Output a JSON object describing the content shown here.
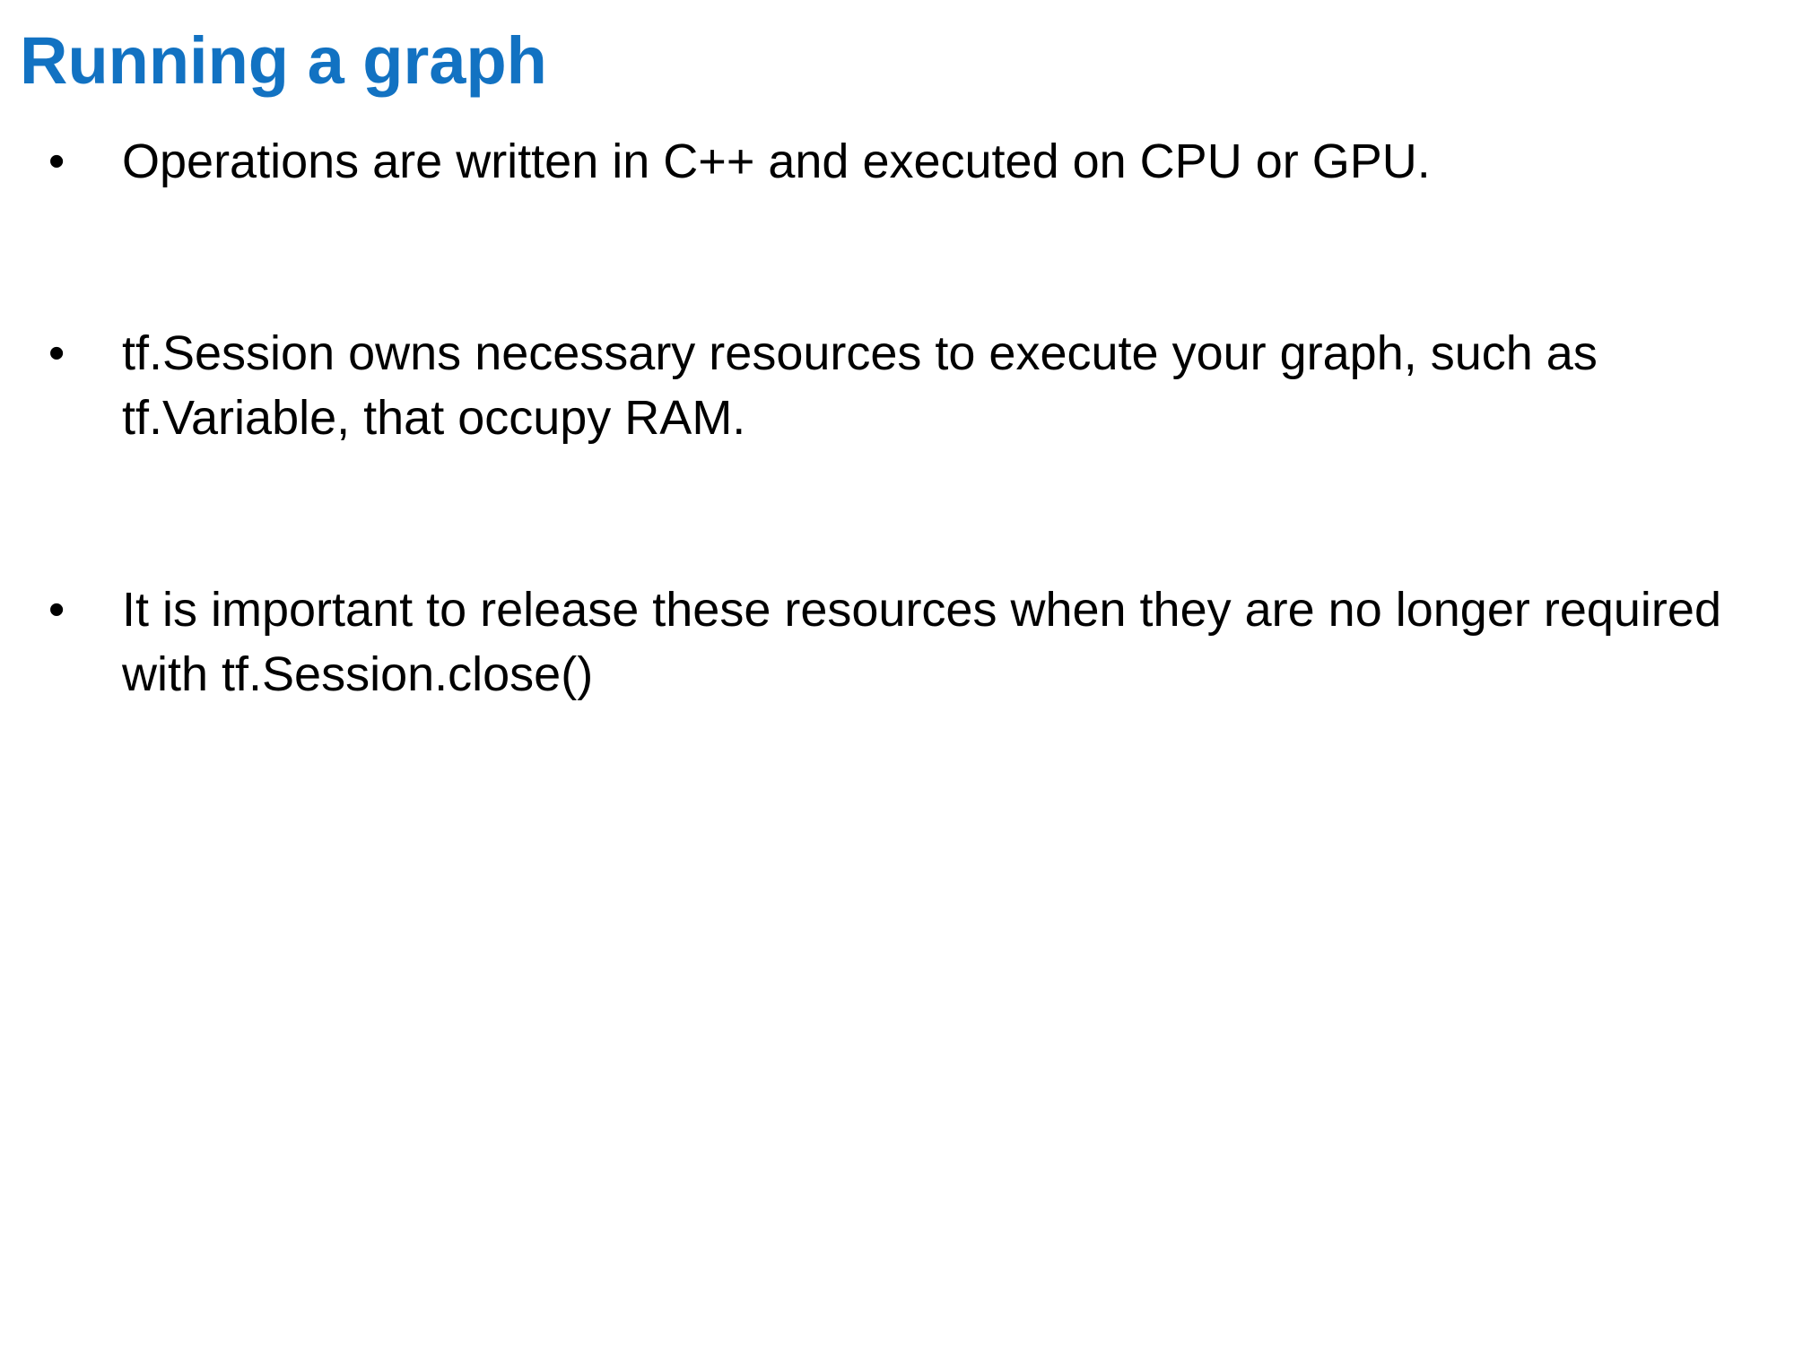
{
  "slide": {
    "title": "Running a graph",
    "title_color": "#1272c2",
    "bullet_glyph": "•",
    "bullets": [
      {
        "text": "Operations are written in C++ and executed on CPU or GPU."
      },
      {
        "text": "tf.Session owns necessary resources to execute your graph, such as tf.Variable, that occupy RAM."
      },
      {
        "text": "It is important to release these resources when they are no longer required with tf.Session.close()"
      }
    ]
  }
}
